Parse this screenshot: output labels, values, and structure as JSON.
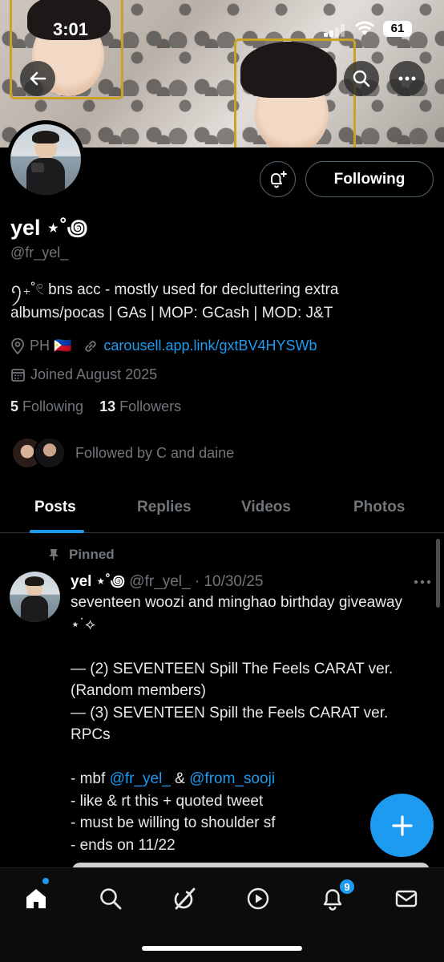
{
  "status_bar": {
    "time": "3:01",
    "battery": "61"
  },
  "profile": {
    "display_name": "yel ⋆˚꩜",
    "handle": "@fr_yel_",
    "bio": "ꪆ₊˚𓏲 bns acc - mostly used for decluttering extra albums/pocas | GAs | MOP: GCash | MOD: J&T",
    "location": "PH 🇵🇭",
    "link": "carousell.app.link/gxtBV4HYSWb",
    "joined": "Joined August 2025",
    "following_count": "5",
    "following_label": "Following",
    "followers_count": "13",
    "followers_label": "Followers",
    "followed_by": "Followed by C and daine",
    "follow_button": "Following"
  },
  "tabs": [
    {
      "label": "Posts",
      "active": true
    },
    {
      "label": "Replies",
      "active": false
    },
    {
      "label": "Videos",
      "active": false
    },
    {
      "label": "Photos",
      "active": false
    }
  ],
  "pinned_post": {
    "pinned_label": "Pinned",
    "author": "yel ⋆˚꩜",
    "handle_date": "@fr_yel_ · 10/30/25",
    "line1": "seventeen woozi and minghao birthday giveaway ⋆˙⟡",
    "line2": "— (2) SEVENTEEN Spill The Feels CARAT ver. (Random members)",
    "line3": "— (3) SEVENTEEN Spill the Feels CARAT ver. RPCs",
    "rule1_prefix": "- mbf ",
    "mention1": "@fr_yel_",
    "rule1_mid": " & ",
    "mention2": "@from_sooji",
    "rule2": "- like & rt this + quoted tweet",
    "rule3": "- must be willing to shoulder sf",
    "rule4": "- ends on 11/22"
  },
  "nav": {
    "notifications_badge": "9"
  },
  "colors": {
    "accent": "#1d9bf0",
    "muted": "#71767b",
    "background": "#000000"
  }
}
